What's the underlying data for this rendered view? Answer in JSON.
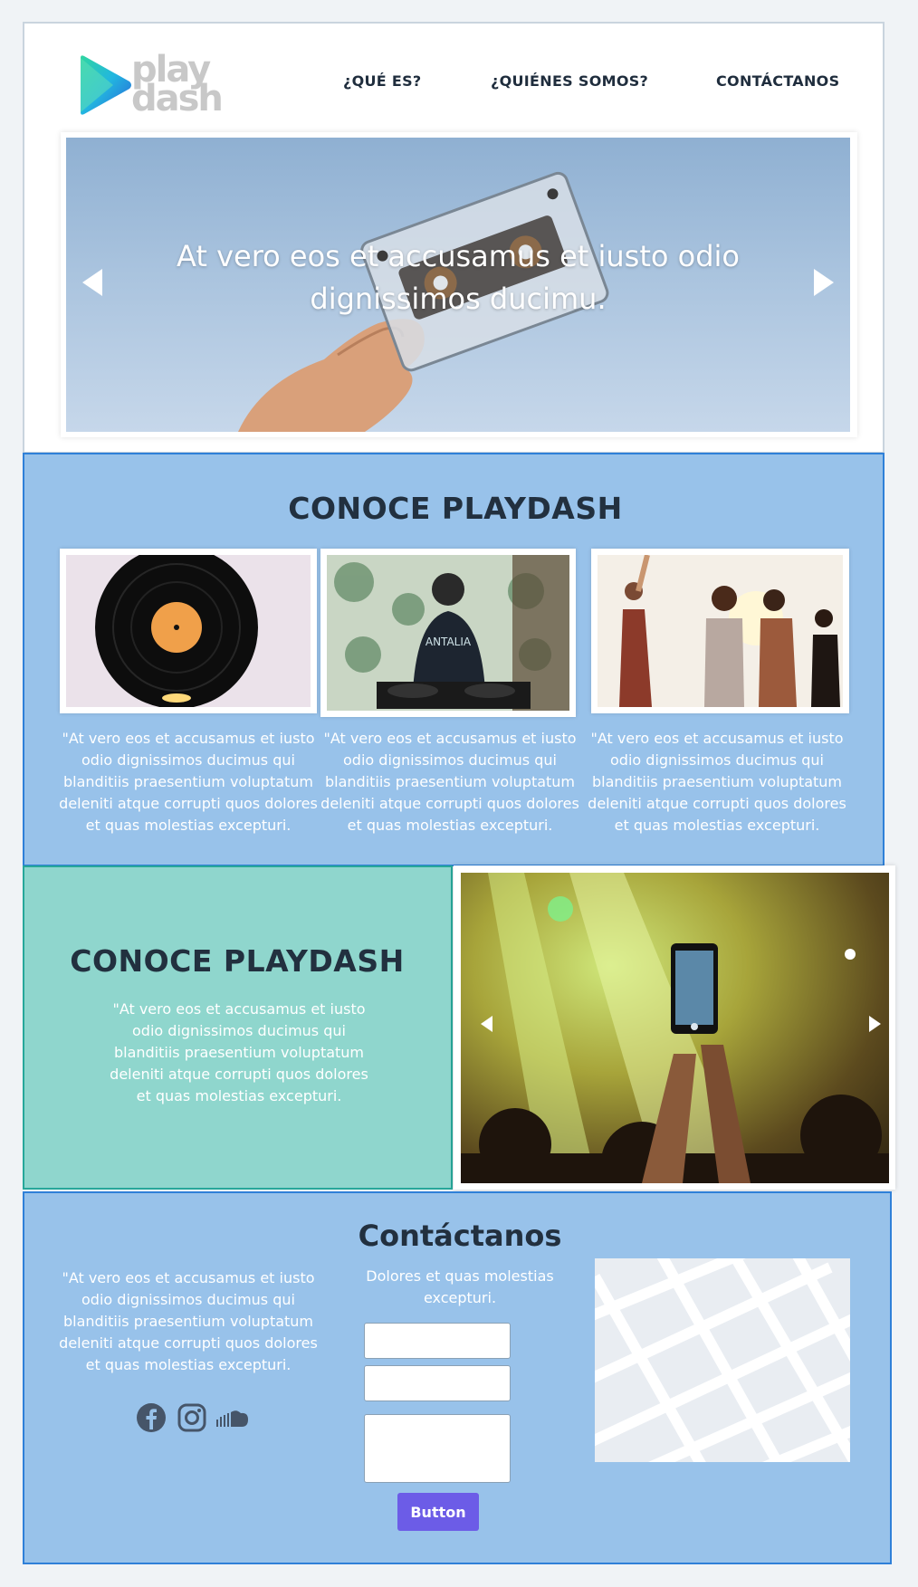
{
  "brand": {
    "logo_line1": "play",
    "logo_line2": "dash"
  },
  "nav": {
    "items": [
      "¿QUÉ ES?",
      "¿QUIÉNES SOMOS?",
      "CONTÁCTANOS"
    ]
  },
  "hero": {
    "caption": "At vero eos et accusamus et iusto odio dignissimos ducimu."
  },
  "conoce1": {
    "title": "CONOCE PLAYDASH",
    "cards": [
      {
        "image": "vinyl-record-photo",
        "text": "\"At vero eos et accusamus et iusto odio dignissimos ducimus qui blanditiis praesentium voluptatum deleniti atque corrupti quos dolores et quas molestias excepturi."
      },
      {
        "image": "dj-turntable-photo",
        "text": "\"At vero eos et accusamus et iusto odio dignissimos ducimus qui blanditiis praesentium voluptatum deleniti atque corrupti quos dolores et quas molestias excepturi."
      },
      {
        "image": "dancing-friends-photo",
        "text": "\"At vero eos et accusamus et iusto odio dignissimos ducimus qui blanditiis praesentium voluptatum deleniti atque corrupti quos dolores et quas molestias excepturi."
      }
    ]
  },
  "conoce2": {
    "title": "CONOCE PLAYDASH",
    "text": "\"At vero eos et accusamus et iusto odio dignissimos ducimus qui blanditiis praesentium voluptatum deleniti atque corrupti quos dolores et quas molestias excepturi."
  },
  "contact": {
    "title": "Contáctanos",
    "text": "\"At vero eos et accusamus et iusto odio dignissimos ducimus qui blanditiis praesentium voluptatum deleniti atque corrupti quos dolores et quas molestias excepturi.",
    "subtitle": "Dolores et quas molestias excepturi.",
    "fields": [
      {
        "value": "",
        "placeholder": ""
      },
      {
        "value": "",
        "placeholder": ""
      },
      {
        "value": "",
        "placeholder": ""
      }
    ],
    "button_label": "Button",
    "social_icons": [
      "facebook-icon",
      "instagram-icon",
      "soundcloud-icon"
    ]
  },
  "colors": {
    "accent_blue": "#98c2ea",
    "teal": "#8fd6cd",
    "button": "#6c5ce7",
    "text_dark": "#22303f"
  }
}
